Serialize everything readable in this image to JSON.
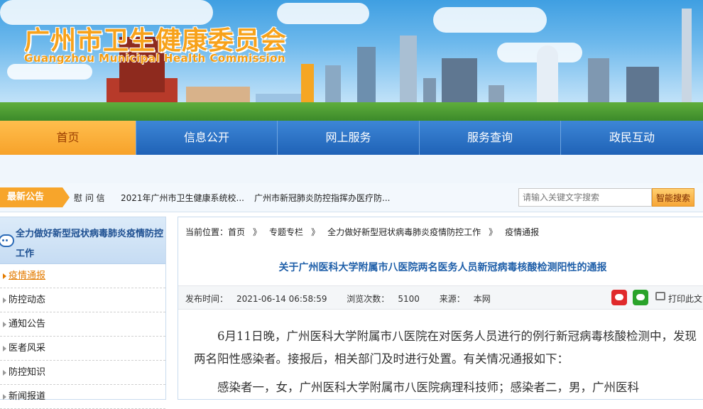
{
  "header": {
    "title_cn": "广州市卫生健康委员会",
    "title_en": "Guangzhou Municipal Health Commission"
  },
  "nav": {
    "items": [
      {
        "label": "首页",
        "active": true
      },
      {
        "label": "信息公开"
      },
      {
        "label": "网上服务"
      },
      {
        "label": "服务查询"
      },
      {
        "label": "政民互动"
      }
    ]
  },
  "notice": {
    "tag": "最新公告",
    "items": [
      "慰 问 信",
      "2021年广州市卫生健康系统校...",
      "广州市新冠肺炎防控指挥办医疗防..."
    ]
  },
  "search": {
    "placeholder": "请输入关键文字搜索",
    "button": "智能搜索"
  },
  "sidebar": {
    "heading": "全力做好新型冠状病毒肺炎疫情防控工作",
    "items": [
      "疫情通报",
      "防控动态",
      "通知公告",
      "医者风采",
      "防控知识",
      "新闻报道"
    ],
    "active_index": 0
  },
  "breadcrumb": {
    "prefix": "当前位置：",
    "items": [
      "首页",
      "专题专栏",
      "全力做好新型冠状病毒肺炎疫情防控工作",
      "疫情通报"
    ],
    "separator": "》"
  },
  "article": {
    "title": "关于广州医科大学附属市八医院两名医务人员新冠病毒核酸检测阳性的通报",
    "published_label": "发布时间：",
    "published": "2021-06-14 06:58:59",
    "views_label": "浏览次数：",
    "views": "5100",
    "source_label": "来源：",
    "source": "本网",
    "print_label": "打印此文",
    "paragraphs": [
      "6月11日晚，广州医科大学附属市八医院在对医务人员进行的例行新冠病毒核酸检测中，发现两名阳性感染者。接报后，相关部门及时进行处置。有关情况通报如下：",
      "感染者一，女，广州医科大学附属市八医院病理科技师；感染者二，男，广州医科"
    ]
  },
  "colors": {
    "nav_blue": "#1f62b6",
    "accent_orange": "#f7a22a",
    "title_blue": "#1f5fa9"
  }
}
